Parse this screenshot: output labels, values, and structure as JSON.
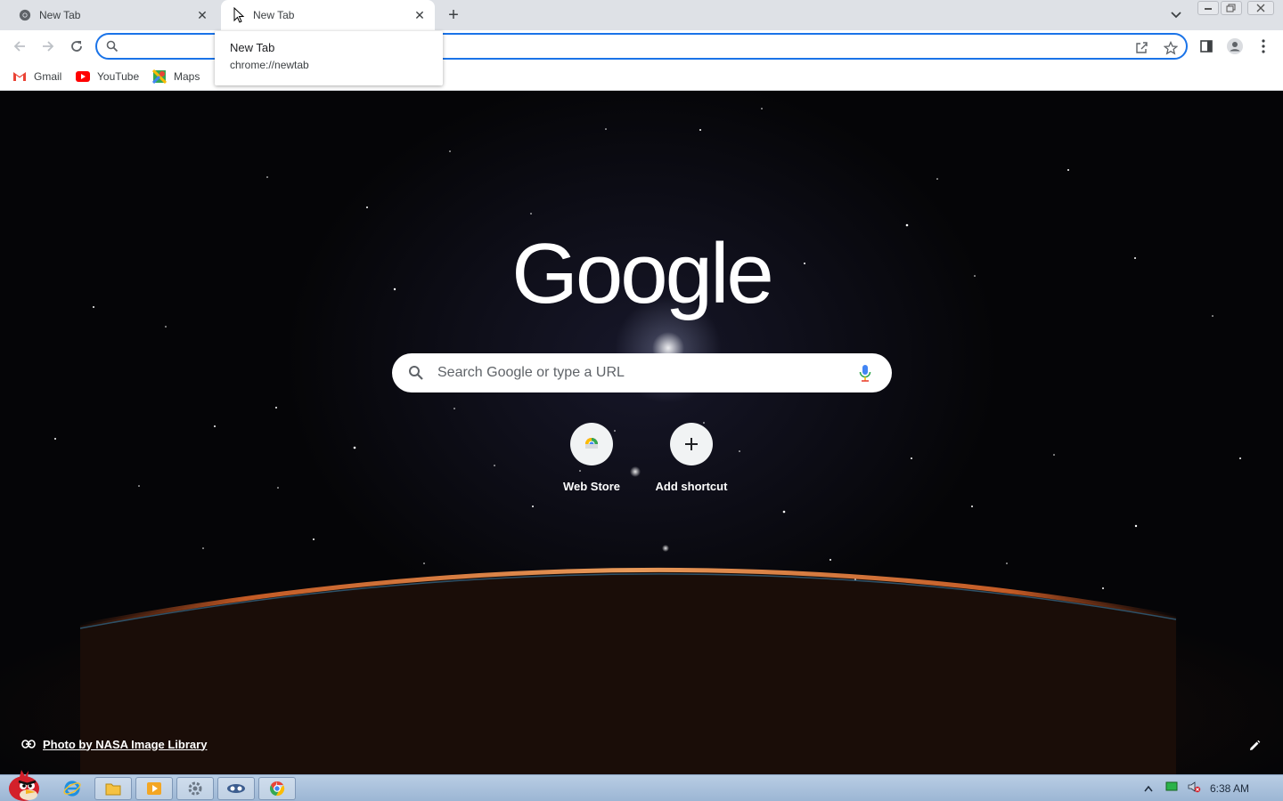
{
  "browser": {
    "tabs": [
      {
        "title": "New Tab",
        "active": false,
        "favicon": "chrome-icon"
      },
      {
        "title": "New Tab",
        "active": true,
        "favicon": "loading-cursor-icon"
      }
    ],
    "new_tab_symbol": "+",
    "close_symbol": "✕",
    "hover_card": {
      "title": "New Tab",
      "url": "chrome://newtab"
    },
    "omnibox": {
      "value": "",
      "placeholder": ""
    },
    "bookmarks": [
      {
        "label": "Gmail",
        "icon": "gmail-icon"
      },
      {
        "label": "YouTube",
        "icon": "youtube-icon"
      },
      {
        "label": "Maps",
        "icon": "maps-icon"
      }
    ],
    "accent_color": "#1a73e8"
  },
  "ntp": {
    "logo": "Google",
    "search_placeholder": "Search Google or type a URL",
    "shortcuts": [
      {
        "label": "Web Store",
        "icon": "chrome-web-store-icon"
      },
      {
        "label": "Add shortcut",
        "icon": "plus-icon"
      }
    ],
    "add_symbol": "+",
    "attribution": "Photo by NASA Image Library"
  },
  "taskbar": {
    "apps": [
      "angry-birds-start-icon",
      "internet-explorer-icon",
      "file-explorer-icon",
      "media-player-icon",
      "settings-icon",
      "app-icon",
      "chrome-icon"
    ],
    "clock": "6:38 AM"
  }
}
